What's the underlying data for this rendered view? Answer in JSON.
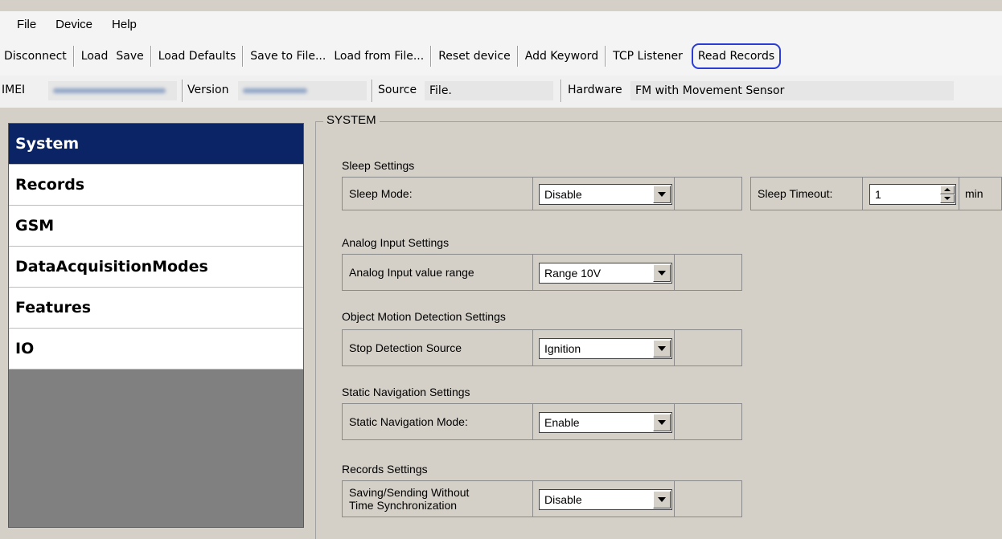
{
  "menu": [
    "File",
    "Device",
    "Help"
  ],
  "toolbar": {
    "disconnect": "Disconnect",
    "load": "Load",
    "save": "Save",
    "load_defaults": "Load Defaults",
    "save_to_file": "Save to File...",
    "load_from_file": "Load from File...",
    "reset_device": "Reset device",
    "add_keyword": "Add Keyword",
    "tcp_listener": "TCP Listener",
    "read_records": "Read Records",
    "highlight_color": "#2a3bd6"
  },
  "info": {
    "imei_label": "IMEI",
    "version_label": "Version",
    "source_label": "Source",
    "source_value": "File.",
    "hardware_label": "Hardware",
    "hardware_value": "FM with Movement Sensor"
  },
  "sidebar": {
    "items": [
      "System",
      "Records",
      "GSM",
      "DataAcquisitionModes",
      "Features",
      "IO"
    ],
    "active": "System",
    "active_color": "#0b2466"
  },
  "system": {
    "group_title": "SYSTEM",
    "sleep": {
      "section": "Sleep Settings",
      "mode_label": "Sleep Mode:",
      "mode_value": "Disable",
      "timeout_label": "Sleep Timeout:",
      "timeout_value": "1",
      "timeout_unit": "min"
    },
    "analog": {
      "section": "Analog Input Settings",
      "label": "Analog Input value range",
      "value": "Range 10V"
    },
    "motion": {
      "section": "Object Motion Detection Settings",
      "label": "Stop Detection Source",
      "value": "Ignition"
    },
    "static_nav": {
      "section": "Static Navigation Settings",
      "label": "Static Navigation Mode:",
      "value": "Enable"
    },
    "records": {
      "section": "Records Settings",
      "label_line1": "Saving/Sending Without",
      "label_line2": "Time Synchronization",
      "value": "Disable"
    }
  }
}
